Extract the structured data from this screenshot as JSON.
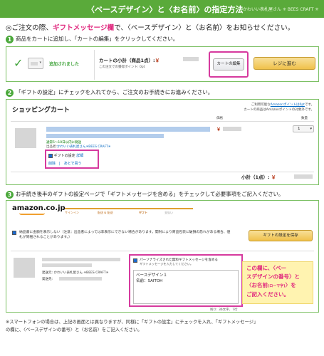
{
  "header": {
    "title": "〈ベースデザイン〉と〈お名前〉の指定方法",
    "brand": "かわいい表札屋さん ✳︎ BEES CRAFT ✳︎"
  },
  "intro": {
    "prefix": "◎ご注文の際、",
    "highlight": "ギフトメッセージ欄",
    "suffix": "で、〈ベースデザイン〉と〈お名前〉をお知らせください。"
  },
  "step1": {
    "num": "1",
    "text": "商品をカートに追加し、「カートの編集」をクリックしてください。",
    "added_label": "追加されました",
    "subtotal_label": "カートの小計（商品1点）:",
    "yen": "￥",
    "points_note": "この注文での獲得ポイント: 0pt",
    "edit_cart_button": "カートの編集",
    "checkout_button": "レジに進む"
  },
  "step2": {
    "num": "2",
    "text": "「ギフトの設定」にチェックを入れてから、ご注文のお手続きにお進みください。",
    "cart_title": "ショッピングカート",
    "note1_prefix": "ご利用可能な",
    "note1_link": "Amazonポイントは0pt",
    "note1_suffix": "です。",
    "note2": "カートの商品はAmazonポイントの対象外です。",
    "price_header": "価格",
    "qty_header": "数量",
    "yen": "￥",
    "qty": "1",
    "stock": "通常5〜10日以内に発送",
    "seller_prefix": "出品者:",
    "seller": "かわいい表札屋さん✳︎BEES CRAFT✳︎",
    "gift_checkbox_label": "ギフトの設定",
    "gift_detail_link": "詳細",
    "delete_link": "削除",
    "save_later_link": "あとで買う",
    "subtotal_label": "小計（1点）:"
  },
  "step3": {
    "num": "3",
    "text": "お手続き後半のギフトの設定ページで「ギフトメッセージを含める」をチェックして必要事項をご記入ください。",
    "logo": "amazon.co.jp",
    "progress_steps": [
      "サインイン",
      "配送 & 配送",
      "ギフト",
      "支払い"
    ],
    "receipt_label": "納品書に金額を表示しない（注意：出品者によっては非表示にできない場合があります。開封により商品包装に破損の恐れがある場合、値札が同梱されることがあります。）",
    "save_gift_button": "ギフトの設定を保存",
    "shipped_by": "発送元: かわいい表札屋さん ✳︎BEES CRAFT✳︎",
    "shipped_to": "発送先:",
    "include_message_label": "パーソナライズされた無料ギフトメッセージを含める",
    "include_message_sub": "ギフトメッセージを入力してください。",
    "message_line1": "ベースデザイン１",
    "message_line2": "名前：SAITOH",
    "char_count": "残り: 36文字、7行"
  },
  "callout": {
    "line1": "この欄に、〈ベー",
    "line2": "スデザインの番号〉と",
    "line3_main": "〈お名前",
    "line3_small": "(ローマ字)",
    "line3_end": "〉を",
    "line4": "ご記入ください。"
  },
  "footer": {
    "line1": "※スマートフォンの場合は、上記の画面とは異なりますが、同様に「ギフトの設定」にチェックを入れ、「ギフトメッセージ」",
    "line2": "の欄に、〈ベースデザインの番号〉と〈お名前〉をご記入ください。"
  }
}
